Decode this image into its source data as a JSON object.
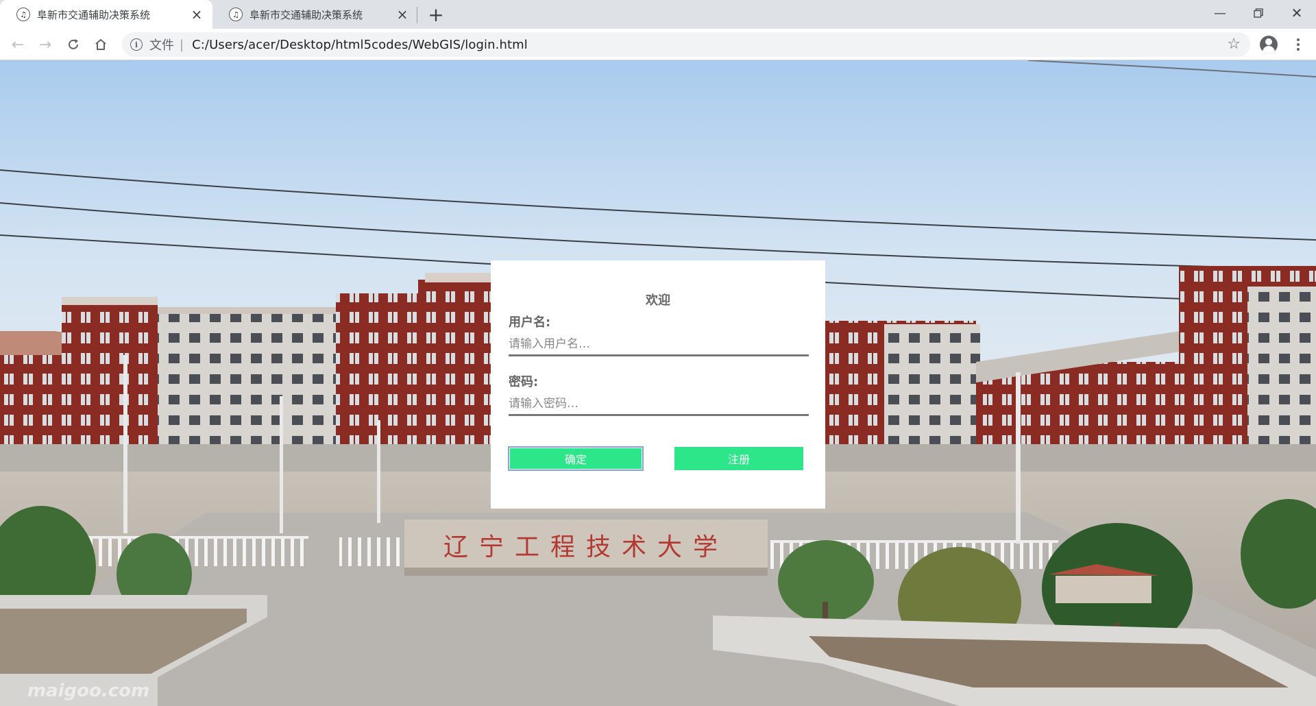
{
  "tabs": [
    {
      "title": "阜新市交通辅助决策系统",
      "active": true
    },
    {
      "title": "阜新市交通辅助决策系统",
      "active": false
    }
  ],
  "toolbar": {
    "scheme_label": "文件",
    "scheme_separator": "|",
    "url": "C:/Users/acer/Desktop/html5codes/WebGIS/login.html"
  },
  "background": {
    "gate_sign": "辽宁工程技术大学",
    "watermark": "maigoo.com"
  },
  "login": {
    "title": "欢迎",
    "username_label": "用户名:",
    "username_placeholder": "请输入用户名…",
    "password_label": "密码:",
    "password_placeholder": "请输入密码…",
    "confirm_label": "确定",
    "register_label": "注册"
  },
  "colors": {
    "button_green": "#2ee68a",
    "brick_red": "#8b2a22",
    "sky": "#b8d4ef"
  }
}
